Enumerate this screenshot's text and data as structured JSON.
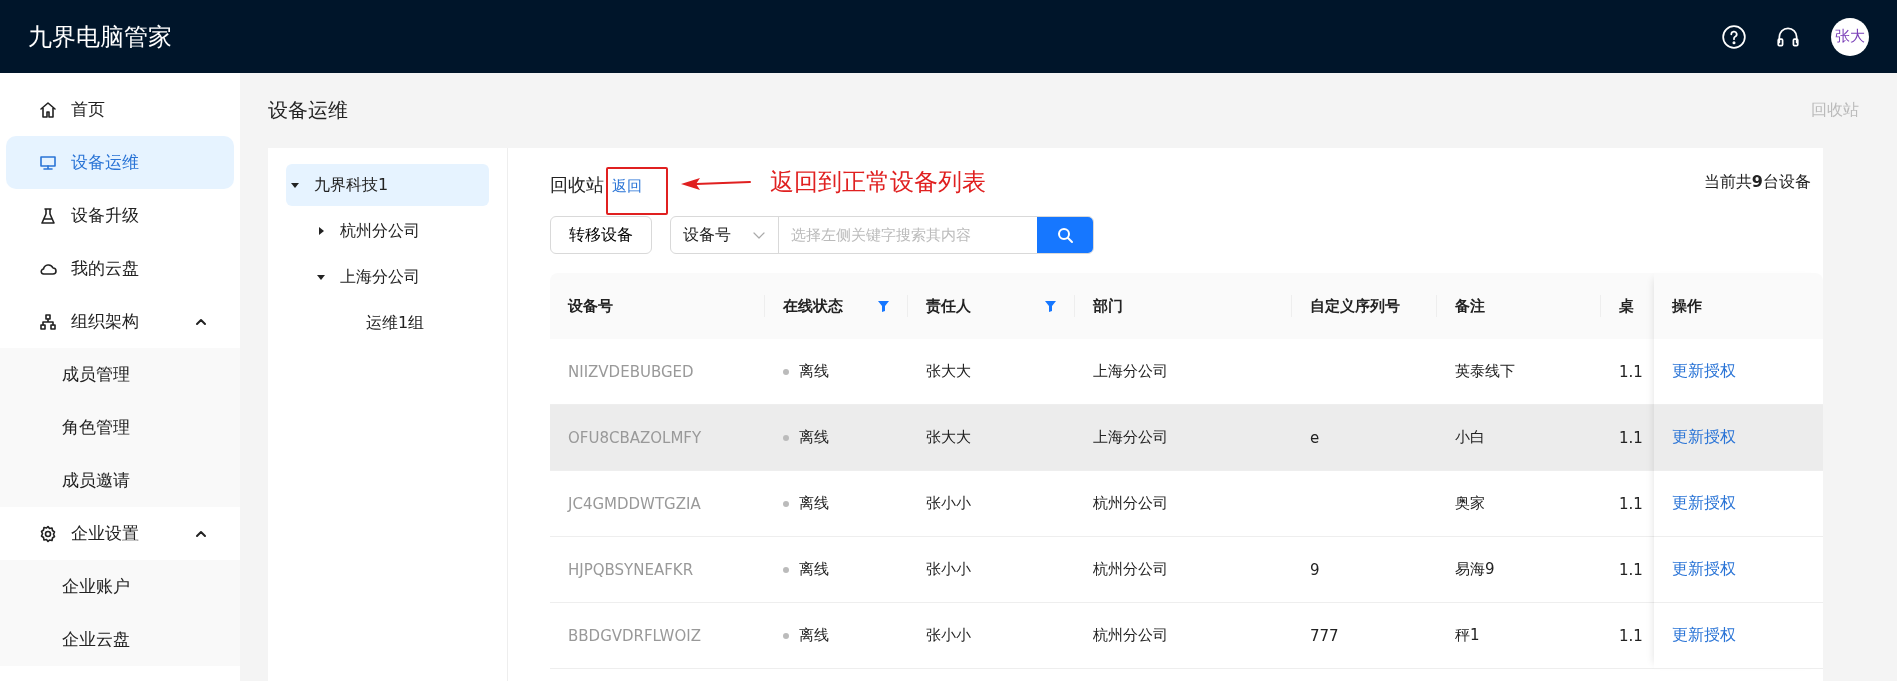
{
  "app": {
    "title": "九界电脑管家",
    "avatar": "张大"
  },
  "sidebar": {
    "items": [
      {
        "label": "首页",
        "selected": false
      },
      {
        "label": "设备运维",
        "selected": true
      },
      {
        "label": "设备升级",
        "selected": false
      },
      {
        "label": "我的云盘",
        "selected": false
      },
      {
        "label": "组织架构",
        "selected": false,
        "expanded": true,
        "children": [
          {
            "label": "成员管理",
            "selected": false
          },
          {
            "label": "角色管理",
            "selected": false
          },
          {
            "label": "成员邀请",
            "selected": false
          }
        ]
      },
      {
        "label": "企业设置",
        "selected": false,
        "expanded": true,
        "children": [
          {
            "label": "企业账户",
            "selected": false
          },
          {
            "label": "企业云盘",
            "selected": false
          }
        ]
      }
    ]
  },
  "page": {
    "title": "设备运维",
    "recycle_link": "回收站"
  },
  "tree": [
    {
      "label": "九界科技1",
      "selected": true,
      "expanded": true,
      "children": [
        {
          "label": "杭州分公司",
          "selected": false,
          "expanded": false
        },
        {
          "label": "上海分公司",
          "selected": false,
          "expanded": true,
          "children": [
            {
              "label": "运维1组",
              "selected": false
            }
          ]
        }
      ]
    }
  ],
  "panel": {
    "title": "回收站",
    "back_link": "返回",
    "count": "当前共**9**台设备"
  },
  "toolbar": {
    "transfer_button": "转移设备",
    "search_key": "设备号",
    "placeholder": "选择左侧关键字搜索其内容"
  },
  "annotation": {
    "text": "返回到正常设备列表"
  },
  "table": {
    "columns": [
      {
        "label": "设备号",
        "filter": false
      },
      {
        "label": "在线状态",
        "filter": true
      },
      {
        "label": "责任人",
        "filter": true
      },
      {
        "label": "部门",
        "filter": false
      },
      {
        "label": "自定义序列号",
        "filter": false
      },
      {
        "label": "备注",
        "filter": false
      },
      {
        "label": "桌",
        "filter": false
      },
      {
        "label": "操作",
        "filter": false
      }
    ],
    "rows": [
      {
        "device": "NIIZVDEBUBGED",
        "online": false,
        "status": "离线",
        "owner": "张大大",
        "dept": "上海分公司",
        "note": "英泰线下",
        "column_7": "1.1",
        "action": "更新授权",
        "highlighted": false
      },
      {
        "device": "OFU8CBAZOLMFY",
        "online": false,
        "status": "离线",
        "owner": "张大大",
        "dept": "上海分公司",
        "serial": "e",
        "note": "小白",
        "column_7": "1.1",
        "action": "更新授权",
        "highlighted": true
      },
      {
        "device": "JC4GMDDWTGZIA",
        "online": false,
        "status": "离线",
        "owner": "张小小",
        "dept": "杭州分公司",
        "note": "奥家",
        "column_7": "1.1",
        "action": "更新授权",
        "highlighted": false
      },
      {
        "device": "HJPQBSYNEAFKR",
        "online": false,
        "status": "离线",
        "owner": "张小小",
        "dept": "杭州分公司",
        "serial": "9",
        "note": "易海9",
        "column_7": "1.1",
        "action": "更新授权",
        "highlighted": false
      },
      {
        "device": "BBDGVDRFLWOIZ",
        "online": false,
        "status": "离线",
        "owner": "张小小",
        "dept": "杭州分公司",
        "serial": "777",
        "note": "秤1",
        "column_7": "1.1",
        "action": "更新授权",
        "highlighted": false
      }
    ]
  }
}
